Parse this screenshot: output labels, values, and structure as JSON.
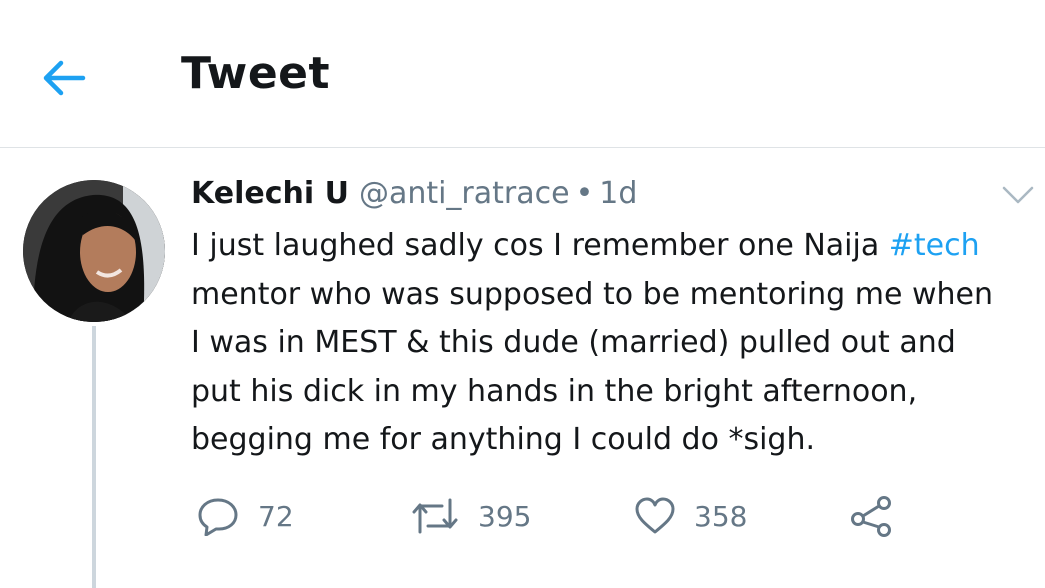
{
  "header": {
    "title": "Tweet",
    "back_icon": "arrow-left-icon",
    "accent_color": "#1da1f2"
  },
  "tweet": {
    "author_name": "Kelechi U",
    "handle": "@anti_ratrace",
    "separator": "•",
    "time_ago": "1d",
    "text_before_hashtag": "I just laughed sadly cos I remember one Naija ",
    "hashtag": "#tech",
    "text_after_hashtag": "\nmentor who was supposed to be mentoring me when\nI was in MEST & this dude (married) pulled out and\nput his dick in my hands in the bright afternoon,\nbegging me for anything I could do  *sigh.",
    "actions": {
      "reply_count": "72",
      "retweet_count": "395",
      "like_count": "358"
    },
    "icons": {
      "reply": "reply-icon",
      "retweet": "retweet-icon",
      "like": "heart-icon",
      "share": "share-icon",
      "menu": "chevron-down-icon"
    }
  }
}
